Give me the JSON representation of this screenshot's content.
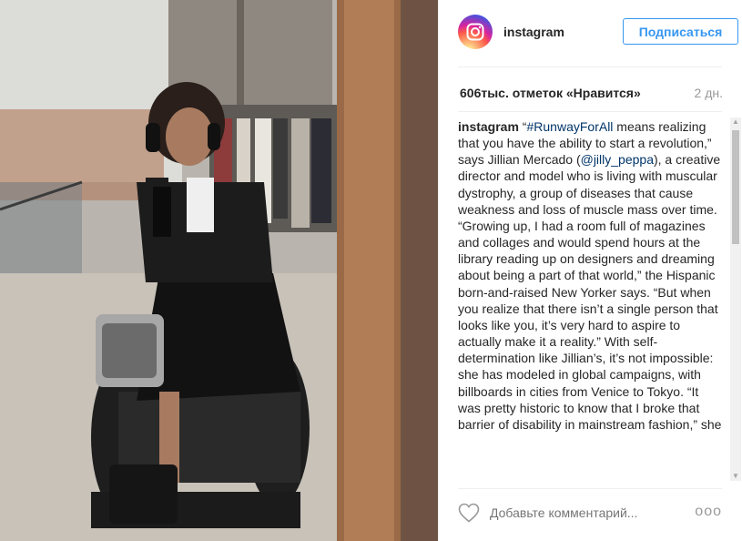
{
  "post": {
    "username": "instagram",
    "follow_label": "Подписаться",
    "likes": "606тыс. отметок «Нравится»",
    "age": "2 дн.",
    "caption": {
      "username": "instagram",
      "part1": " “",
      "hashtag": "#RunwayForAll",
      "part2": " means realizing that you have the ability to start a revolution,” says Jillian Mercado (",
      "mention": "@jilly_peppa",
      "part3": "), a creative director and model who is living with muscular dystrophy, a group of diseases that cause weakness and loss of muscle mass over time. “Growing up, I had a room full of magazines and collages and would spend hours at the library reading up on designers and dreaming about being a part of that world,” the Hispanic born-and-raised New Yorker says. “But when you realize that there isn’t a single person that looks like you, it’s very hard to aspire to actually make it a reality.” With self-determination like Jillian’s, it’s not impossible: she has modeled in global campaigns, with billboards in cities from Venice to Tokyo. “It was pretty historic to know that I broke that barrier of disability in mainstream fashion,” she"
    },
    "comment_placeholder": "Добавьте комментарий...",
    "more_label": "ооо"
  },
  "icons": {
    "avatar": "instagram-logo-icon",
    "like": "heart-icon",
    "more": "more-options-icon"
  },
  "colors": {
    "accent": "#3897f0",
    "hashtag": "#003569",
    "muted": "#999999"
  }
}
